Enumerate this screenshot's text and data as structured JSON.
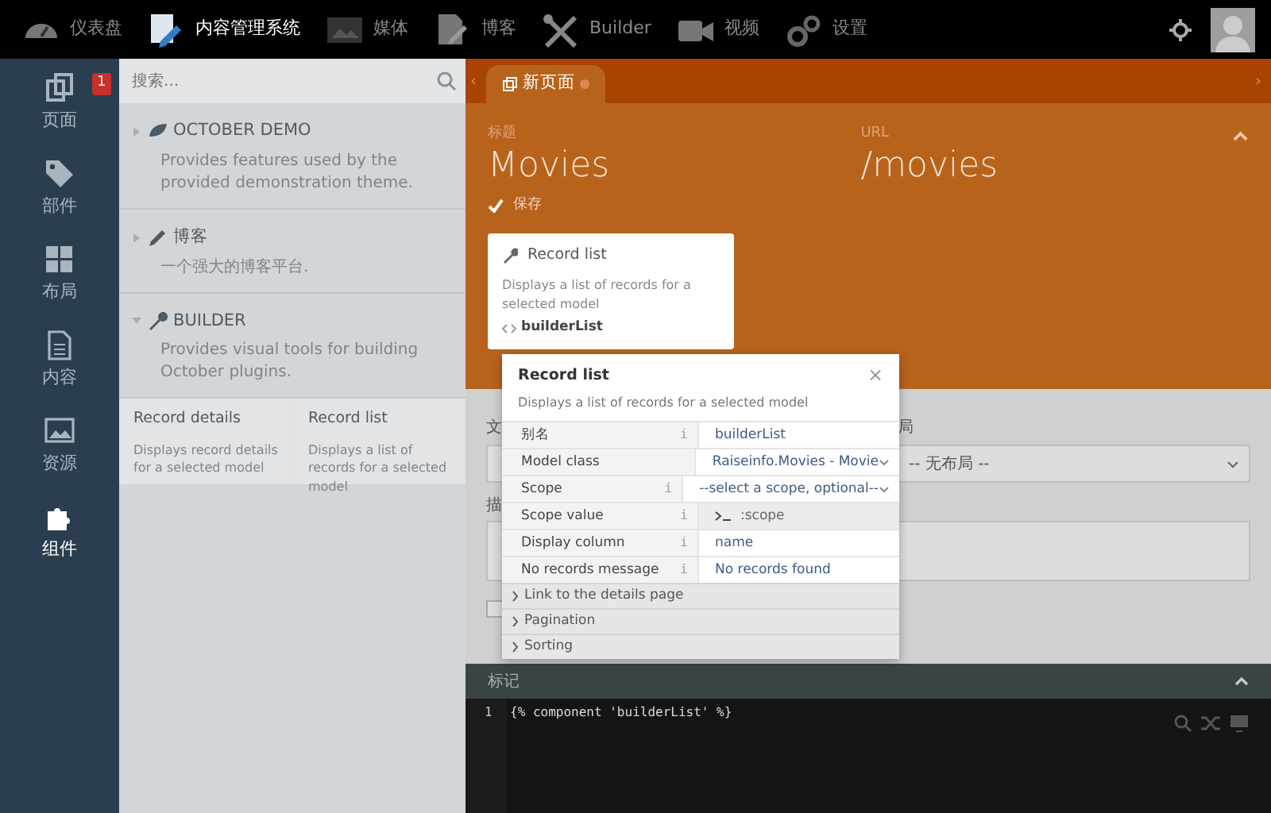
{
  "topnav": {
    "items": [
      {
        "label": "仪表盘",
        "selected": false
      },
      {
        "label": "内容管理系统",
        "selected": true
      },
      {
        "label": "媒体",
        "selected": false
      },
      {
        "label": "博客",
        "selected": false
      },
      {
        "label": "Builder",
        "selected": false
      },
      {
        "label": "视频",
        "selected": false
      },
      {
        "label": "设置",
        "selected": false
      }
    ]
  },
  "sidebar": {
    "items": [
      {
        "label": "页面",
        "selected": false,
        "badge": "1"
      },
      {
        "label": "部件",
        "selected": false
      },
      {
        "label": "布局",
        "selected": false
      },
      {
        "label": "内容",
        "selected": false
      },
      {
        "label": "资源",
        "selected": false
      },
      {
        "label": "组件",
        "selected": true
      }
    ]
  },
  "components_panel": {
    "search": {
      "placeholder": "搜索..."
    },
    "groups": [
      {
        "title": "OCTOBER DEMO",
        "description": "Provides features used by the provided demonstration theme.",
        "expanded": false
      },
      {
        "title": "博客",
        "description": "一个强大的博客平台.",
        "expanded": false
      },
      {
        "title": "BUILDER",
        "description": "Provides visual tools for building October plugins.",
        "expanded": true,
        "components": [
          {
            "name": "Record details",
            "description": "Displays record details for a selected model"
          },
          {
            "name": "Record list",
            "description": "Displays a list of records for a selected model"
          }
        ]
      }
    ]
  },
  "editor": {
    "tab": {
      "label": "新页面",
      "scroll_left": "‹",
      "scroll_right": "›"
    },
    "title": {
      "label": "标题",
      "value": "Movies"
    },
    "url": {
      "label": "URL",
      "value": "/movies"
    },
    "save_status": "保存",
    "form": {
      "file_label": "文",
      "layout_label": "局",
      "layout_value": "-- 无布局 --",
      "description_label": "描",
      "checkbox": {
        "checked": false
      }
    },
    "markup_bar": {
      "label": "标记"
    },
    "code": {
      "lines": [
        {
          "number": "1",
          "text": "{% component 'builderList' %}"
        }
      ]
    }
  },
  "component_card": {
    "name": "Record list",
    "description": "Displays a list of records for a selected model",
    "alias": "builderList"
  },
  "inspector": {
    "title": "Record list",
    "description": "Displays a list of records for a selected model",
    "close": "×",
    "properties": [
      {
        "kind": "text",
        "label": "别名",
        "value": "builderList",
        "info": "i"
      },
      {
        "kind": "dropdown",
        "label": "Model class",
        "value": "Raiseinfo.Movies - Movie"
      },
      {
        "kind": "dropdown",
        "label": "Scope",
        "value": "--select a scope, optional--",
        "info": "i"
      },
      {
        "kind": "code",
        "label": "Scope value",
        "value": ":scope",
        "info": "i"
      },
      {
        "kind": "text",
        "label": "Display column",
        "value": "name",
        "info": "i"
      },
      {
        "kind": "text",
        "label": "No records message",
        "value": "No records found",
        "info": "i"
      }
    ],
    "sections": [
      {
        "label": "Link to the details page",
        "expanded": false
      },
      {
        "label": "Pagination",
        "expanded": false
      },
      {
        "label": "Sorting",
        "expanded": false
      }
    ]
  }
}
